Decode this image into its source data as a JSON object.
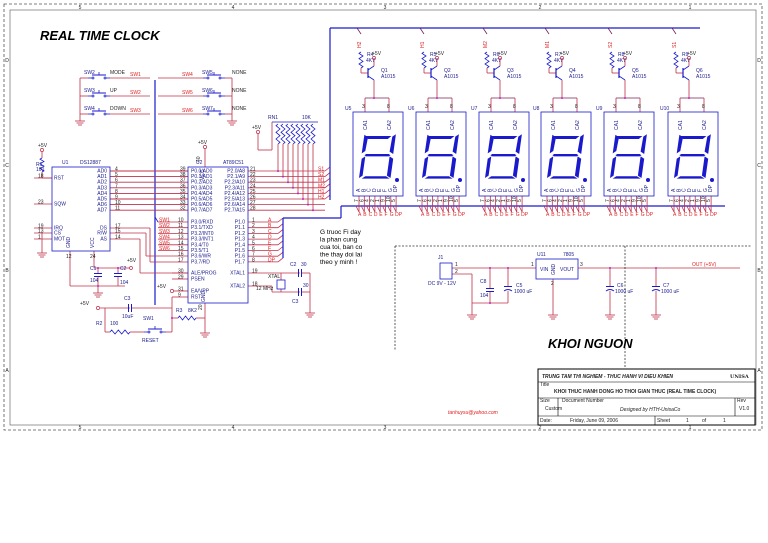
{
  "title": "REAL TIME CLOCK",
  "power_title": "KHOI NGUON",
  "email": "tanhuysu@yahoo.com",
  "note": [
    "G truoc Fi day",
    "la phan cung",
    "cua toi, ban co",
    "the thay doi lai",
    "theo y minh !"
  ],
  "vcc": "+5V",
  "switches": [
    {
      "ref": "SW2",
      "label": "MODE",
      "net": "SW1"
    },
    {
      "ref": "SW3",
      "label": "UP",
      "net": "SW2"
    },
    {
      "ref": "SW4",
      "label": "DOWN",
      "net": "SW3"
    },
    {
      "ref": "SW5",
      "label": "NONE",
      "net": "SW4"
    },
    {
      "ref": "SW6",
      "label": "NONE",
      "net": "SW5"
    },
    {
      "ref": "SW7",
      "label": "NONE",
      "net": "SW6"
    }
  ],
  "u1": {
    "ref": "U1",
    "part": "DS12887",
    "ad_pins": [
      {
        "name": "AD0",
        "num": "4"
      },
      {
        "name": "AD1",
        "num": "5"
      },
      {
        "name": "AD2",
        "num": "6"
      },
      {
        "name": "AD3",
        "num": "7"
      },
      {
        "name": "AD4",
        "num": "8"
      },
      {
        "name": "AD5",
        "num": "9"
      },
      {
        "name": "AD6",
        "num": "10"
      },
      {
        "name": "AD7",
        "num": "11"
      }
    ],
    "left_pins": [
      {
        "name": "RST",
        "num": "18"
      },
      {
        "name": "SQW",
        "num": "23"
      },
      {
        "name": "IRQ",
        "num": "19"
      },
      {
        "name": "CS",
        "num": "13"
      },
      {
        "name": "MOT",
        "num": "1"
      }
    ],
    "ctrl_pins": [
      {
        "name": "DS",
        "num": "17"
      },
      {
        "name": "R/W",
        "num": "15"
      },
      {
        "name": "AS",
        "num": "14"
      }
    ],
    "gnd": "GND",
    "gnd_num": "12",
    "vcc": "VCC",
    "vcc_num": "24"
  },
  "r1": {
    "ref": "R1",
    "value": "100"
  },
  "u2": {
    "ref": "U2",
    "part": "AT89C51",
    "p0": [
      {
        "name": "P0.0/AD0",
        "num": "39"
      },
      {
        "name": "P0.1/AD1",
        "num": "38"
      },
      {
        "name": "P0.2/AD2",
        "num": "37"
      },
      {
        "name": "P0.3/AD3",
        "num": "36"
      },
      {
        "name": "P0.4/AD4",
        "num": "35"
      },
      {
        "name": "P0.5/AD5",
        "num": "34"
      },
      {
        "name": "P0.6/AD6",
        "num": "33"
      },
      {
        "name": "P0.7/AD7",
        "num": "32"
      }
    ],
    "p3": [
      {
        "name": "P3.0/RXD",
        "num": "10"
      },
      {
        "name": "P3.1/TXD",
        "num": "11"
      },
      {
        "name": "P3.2/INT0",
        "num": "12"
      },
      {
        "name": "P3.3/INT1",
        "num": "13"
      },
      {
        "name": "P3.4/T0",
        "num": "14"
      },
      {
        "name": "P3.5/T1",
        "num": "15"
      },
      {
        "name": "P3.6/WR",
        "num": "16"
      },
      {
        "name": "P3.7/RD",
        "num": "17"
      }
    ],
    "misc_left": [
      {
        "name": "ALE/PROG",
        "num": "30"
      },
      {
        "name": "PSEN",
        "num": "29"
      },
      {
        "name": "EA/VPP",
        "num": "31"
      },
      {
        "name": "RST",
        "num": "9"
      }
    ],
    "p2": [
      {
        "name": "P2.0/A8",
        "num": "21"
      },
      {
        "name": "P2.1/A9",
        "num": "22"
      },
      {
        "name": "P2.2/A10",
        "num": "23"
      },
      {
        "name": "P2.3/A11",
        "num": "24"
      },
      {
        "name": "P2.4/A12",
        "num": "25"
      },
      {
        "name": "P2.5/A13",
        "num": "26"
      },
      {
        "name": "P2.6/A14",
        "num": "27"
      },
      {
        "name": "P2.7/A15",
        "num": "28"
      }
    ],
    "p1": [
      {
        "name": "P1.0",
        "num": "1"
      },
      {
        "name": "P1.1",
        "num": "2"
      },
      {
        "name": "P1.2",
        "num": "3"
      },
      {
        "name": "P1.3",
        "num": "4"
      },
      {
        "name": "P1.4",
        "num": "5"
      },
      {
        "name": "P1.5",
        "num": "6"
      },
      {
        "name": "P1.6",
        "num": "7"
      },
      {
        "name": "P1.7",
        "num": "8"
      }
    ],
    "xtal": [
      {
        "name": "XTAL1",
        "num": "19"
      },
      {
        "name": "XTAL2",
        "num": "18"
      }
    ],
    "vcc": "VCC",
    "vcc_num": "40",
    "gnd": "GND",
    "gnd_num": "20"
  },
  "p3_nets": [
    "SW1",
    "SW2",
    "SW3",
    "SW4",
    "SW5",
    "SW6"
  ],
  "p2_nets": [
    "S1",
    "S2",
    "M1",
    "M2",
    "H1",
    "H2"
  ],
  "seg_nets": [
    "A",
    "B",
    "C",
    "D",
    "E",
    "F",
    "G",
    "DP"
  ],
  "rn1": {
    "ref": "RN1",
    "value": "10K"
  },
  "crystal": {
    "c2": "C2",
    "c2_val": "30",
    "c3": "C3",
    "c3_val": "30",
    "xtal": "XTAL",
    "freq": "12 MHz"
  },
  "decoupling": [
    {
      "ref": "C1",
      "value": "104"
    },
    {
      "ref": "C2",
      "value": "104"
    }
  ],
  "reset": {
    "c3": "C3",
    "c3_val": "10uF",
    "r2": "R2",
    "r2_val": "100",
    "sw": "SW1",
    "sw_label": "RESET",
    "r3": "R3",
    "r3_val": "8K2"
  },
  "digits": [
    {
      "ref": "U5",
      "net": "H2",
      "r": "R4",
      "q": "Q1"
    },
    {
      "ref": "U6",
      "net": "H1",
      "r": "R5",
      "q": "Q2"
    },
    {
      "ref": "U7",
      "net": "M2",
      "r": "R6",
      "q": "Q3"
    },
    {
      "ref": "U8",
      "net": "M1",
      "r": "R7",
      "q": "Q4"
    },
    {
      "ref": "U9",
      "net": "S2",
      "r": "R8",
      "q": "Q5"
    },
    {
      "ref": "U10",
      "net": "S1",
      "r": "R9",
      "q": "Q6"
    }
  ],
  "digit_common": {
    "r_val": "4K7",
    "q_part": "A1015",
    "ca1": "CA1",
    "ca2": "CA2",
    "ca1_pin": "3",
    "ca2_pin": "8",
    "segs": [
      "A",
      "B",
      "C",
      "D",
      "E",
      "F",
      "G",
      "DP"
    ],
    "seg_pins": [
      "7",
      "6",
      "4",
      "2",
      "1",
      "9",
      "10",
      "5"
    ]
  },
  "power": {
    "j1": "J1",
    "j1_label": "DC 9V - 12V",
    "j1_p1": "1",
    "j1_p2": "2",
    "c8": "C8",
    "c8_val": "104",
    "c5": "C5",
    "c5_val": "1000 uF",
    "u11": "U11",
    "u11_part": "7805",
    "vin": "VIN",
    "vout": "VOUT",
    "gnd": "GND",
    "pin1": "1",
    "pin2": "2",
    "pin3": "3",
    "c6": "C6",
    "c6_val": "1000 uF",
    "c7": "C7",
    "c7_val": "1000 uF",
    "out": "OUT (+5V)"
  },
  "title_block": {
    "org": "TRUNG TAM THI NGHIEM - THUC HANH VI DIEU KHIEN",
    "logo": "UNISA",
    "title_label": "Title",
    "title": "KHOI THUC HANH DONG HO THOI GIAN THUC (REAL TIME CLOCK)",
    "size_label": "Size",
    "size": "Custom",
    "docnum_label": "Document Number",
    "docnum": "Designed by HTH-UnisaCo",
    "rev_label": "Rev",
    "rev": "V1.0",
    "date_label": "Date:",
    "date": "Friday, June 09, 2006",
    "sheet_label": "Sheet",
    "sheet": "1",
    "of_label": "of",
    "sheets": "1"
  },
  "frame": {
    "cols": [
      "5",
      "4",
      "3",
      "2",
      "1"
    ],
    "rows": [
      "D",
      "C",
      "B",
      "A"
    ]
  }
}
